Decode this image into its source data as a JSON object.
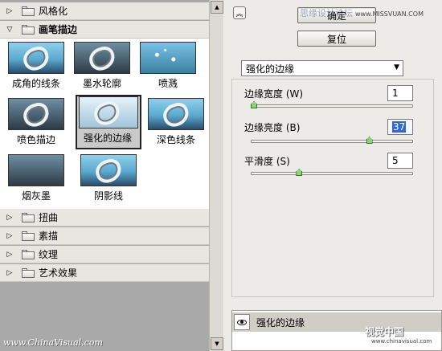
{
  "gallery": {
    "categories_top": [
      {
        "label": "风格化",
        "state": "collapsed"
      },
      {
        "label": "画笔描边",
        "state": "expanded"
      }
    ],
    "thumbnails": [
      {
        "label": "成角的线条",
        "icon": "thumb-angled-strokes"
      },
      {
        "label": "墨水轮廓",
        "icon": "thumb-ink-outlines"
      },
      {
        "label": "喷溅",
        "icon": "thumb-spatter"
      },
      {
        "label": "喷色描边",
        "icon": "thumb-sprayed-strokes"
      },
      {
        "label": "强化的边缘",
        "icon": "thumb-accented-edges",
        "selected": true
      },
      {
        "label": "深色线条",
        "icon": "thumb-dark-strokes"
      },
      {
        "label": "烟灰墨",
        "icon": "thumb-sumi-e"
      },
      {
        "label": "阴影线",
        "icon": "thumb-crosshatch"
      }
    ],
    "categories_bottom": [
      {
        "label": "扭曲",
        "state": "collapsed"
      },
      {
        "label": "素描",
        "state": "collapsed"
      },
      {
        "label": "纹理",
        "state": "collapsed"
      },
      {
        "label": "艺术效果",
        "state": "collapsed"
      }
    ],
    "watermark": "www.ChinaVisual.com"
  },
  "toolbar": {
    "ok_label": "确定",
    "reset_label": "复位",
    "watermark": "思缘设计论坛",
    "watermark_site": "www.MISSVUAN.COM"
  },
  "filter": {
    "selected": "强化的边缘"
  },
  "params": [
    {
      "label": "边缘宽度 (W)",
      "value": "1",
      "fraction": 0.0
    },
    {
      "label": "边缘亮度 (B)",
      "value": "37",
      "fraction": 0.74,
      "active": true
    },
    {
      "label": "平滑度 (S)",
      "value": "5",
      "fraction": 0.29
    }
  ],
  "layers": {
    "name": "强化的边缘"
  },
  "watermark_right": "视觉中国",
  "watermark_right_url": "www.chinavisual.com",
  "colors": {
    "accent_selection": "#316ac5",
    "slider_thumb": "#8fd07c",
    "gallery_bg": "#ffffff"
  }
}
